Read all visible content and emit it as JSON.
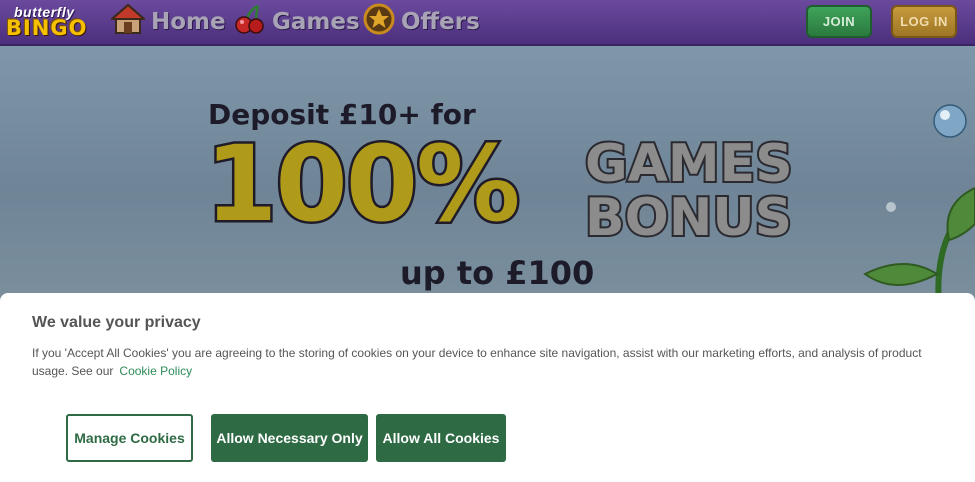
{
  "header": {
    "logo_top": "butterfly",
    "logo_bottom": "BINGO",
    "nav": [
      {
        "label": "Home",
        "icon": "house-icon"
      },
      {
        "label": "Games",
        "icon": "cherries-icon"
      },
      {
        "label": "Offers",
        "icon": "star-icon"
      }
    ],
    "join_label": "JOIN",
    "login_label": "LOG IN"
  },
  "hero": {
    "line1": "Deposit £10+ for",
    "big": "100%",
    "games": "GAMES",
    "bonus": "BONUS",
    "line3": "up to £100"
  },
  "cookie": {
    "title": "We value your privacy",
    "text": "If you 'Accept All Cookies' you are agreeing to the storing of cookies on your device to enhance site navigation, assist with our marketing efforts, and analysis of product usage. See our",
    "link": "Cookie Policy",
    "manage_label": "Manage Cookies",
    "necessary_label": "Allow Necessary Only",
    "all_label": "Allow All Cookies"
  },
  "colors": {
    "header": "#4b2f7c",
    "join": "#2a7a3e",
    "login": "#9e7624",
    "cookie_accent": "#2e6b44"
  }
}
